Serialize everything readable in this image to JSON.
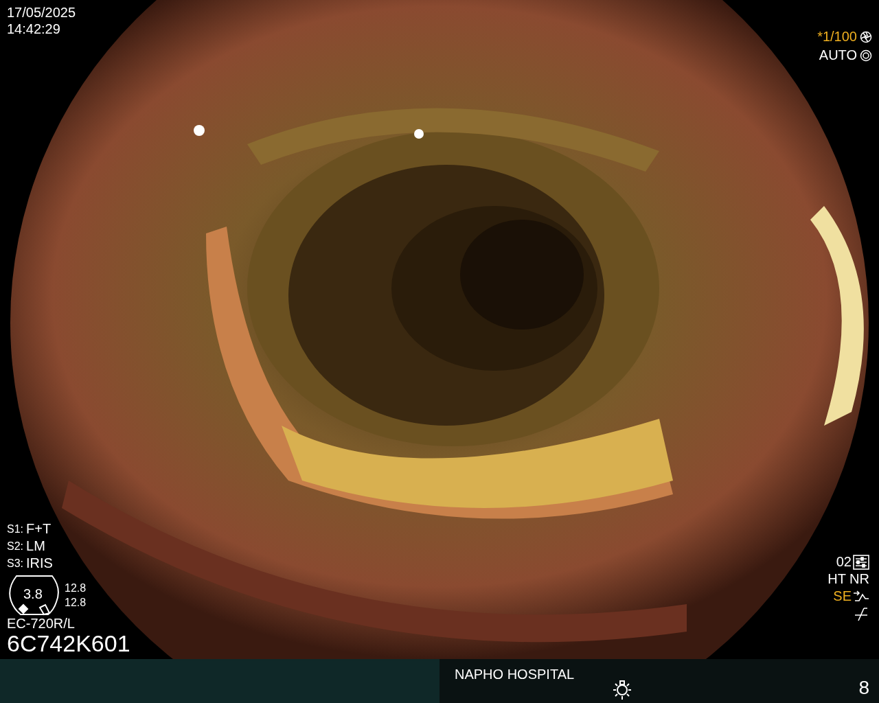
{
  "datetime": {
    "date": "17/05/2025",
    "time": "14:42:29"
  },
  "exposure": {
    "shutter": "*1/100",
    "mode": "AUTO"
  },
  "settings": [
    {
      "label": "S1:",
      "value": "F+T"
    },
    {
      "label": "S2:",
      "value": "LM"
    },
    {
      "label": "S3:",
      "value": "IRIS"
    }
  ],
  "bending": {
    "center": "3.8",
    "readings": [
      "12.8",
      "12.8"
    ]
  },
  "scope": {
    "model": "EC-720R/L",
    "serial": "6C742K601"
  },
  "processing": [
    {
      "kind": "preset",
      "text": "02"
    },
    {
      "kind": "plain",
      "text": "HT NR"
    },
    {
      "kind": "highlight",
      "text": "SE"
    },
    {
      "kind": "icon"
    }
  ],
  "footer": {
    "hospital": "NAPHO HOSPITAL",
    "counter": "8"
  }
}
